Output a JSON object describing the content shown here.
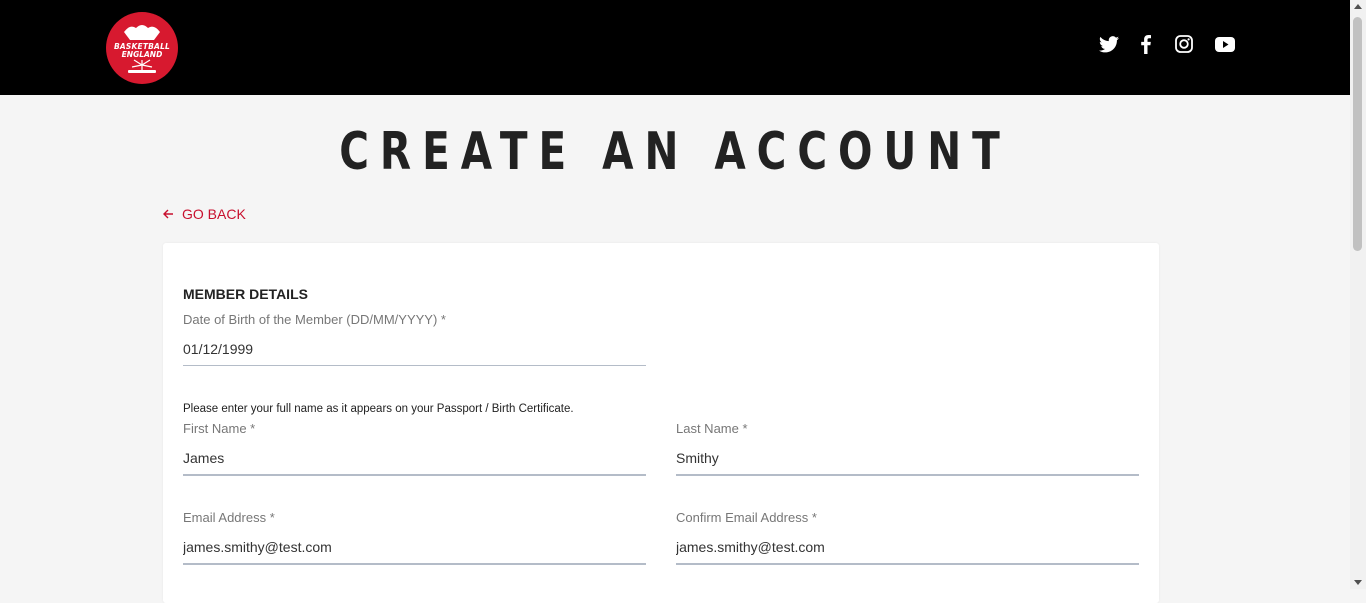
{
  "header": {
    "logo_line1": "BASKETBALL",
    "logo_line2": "ENGLAND",
    "social": [
      "twitter-icon",
      "facebook-icon",
      "instagram-icon",
      "youtube-icon"
    ]
  },
  "page": {
    "title": "CREATE AN ACCOUNT",
    "back_label": "GO BACK"
  },
  "form": {
    "section_title": "MEMBER DETAILS",
    "dob": {
      "label": "Date of Birth of the Member (DD/MM/YYYY) *",
      "value": "01/12/1999"
    },
    "helper_text": "Please enter your full name as it appears on your Passport / Birth Certificate.",
    "first_name": {
      "label": "First Name *",
      "value": "James"
    },
    "last_name": {
      "label": "Last Name *",
      "value": "Smithy"
    },
    "email": {
      "label": "Email Address *",
      "value": "james.smithy@test.com"
    },
    "confirm_email": {
      "label": "Confirm Email Address *",
      "value": "james.smithy@test.com"
    }
  },
  "colors": {
    "brand_red": "#c8102e",
    "header_bg": "#000000",
    "page_bg": "#f5f5f5"
  }
}
